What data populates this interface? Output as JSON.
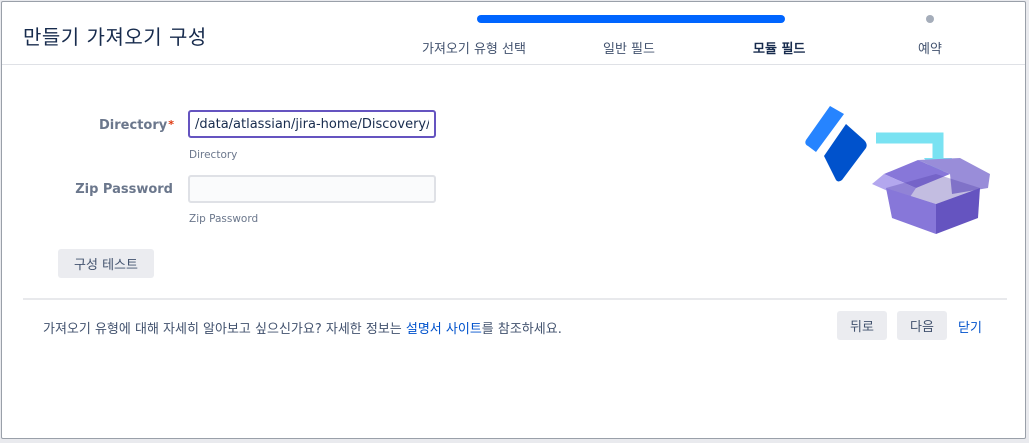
{
  "dialog": {
    "title": "만들기 가져오기 구성"
  },
  "wizard": {
    "progress_completed_steps": 3,
    "progress_total_steps": 4,
    "steps": [
      {
        "label": "가져오기 유형 선택"
      },
      {
        "label": "일반 필드"
      },
      {
        "label": "모듈 필드"
      },
      {
        "label": "예약"
      }
    ],
    "current_step": "모듈 필드"
  },
  "form": {
    "directory": {
      "label": "Directory",
      "required_mark": "*",
      "value": "/data/atlassian/jira-home/Discovery/sc",
      "help": "Directory"
    },
    "zip_password": {
      "label": "Zip Password",
      "value": "",
      "help": "Zip Password"
    },
    "test_button": "구성 테스트"
  },
  "footer": {
    "text_before": "가져오기 유형에 대해 자세히 알아보고 싶으신가요? 자세한 정보는 ",
    "link_text": "설명서 사이트",
    "text_after": "를 참조하세요.",
    "back_button": "뒤로",
    "next_button": "다음",
    "close_link": "닫기"
  },
  "colors": {
    "progress_active": "#0065ff",
    "progress_pending": "#a5adba",
    "focus_border": "#6554c0",
    "link": "#0052cc",
    "required": "#de350b"
  },
  "icons": {
    "illustration": "jira-logo-box-import-illustration"
  }
}
